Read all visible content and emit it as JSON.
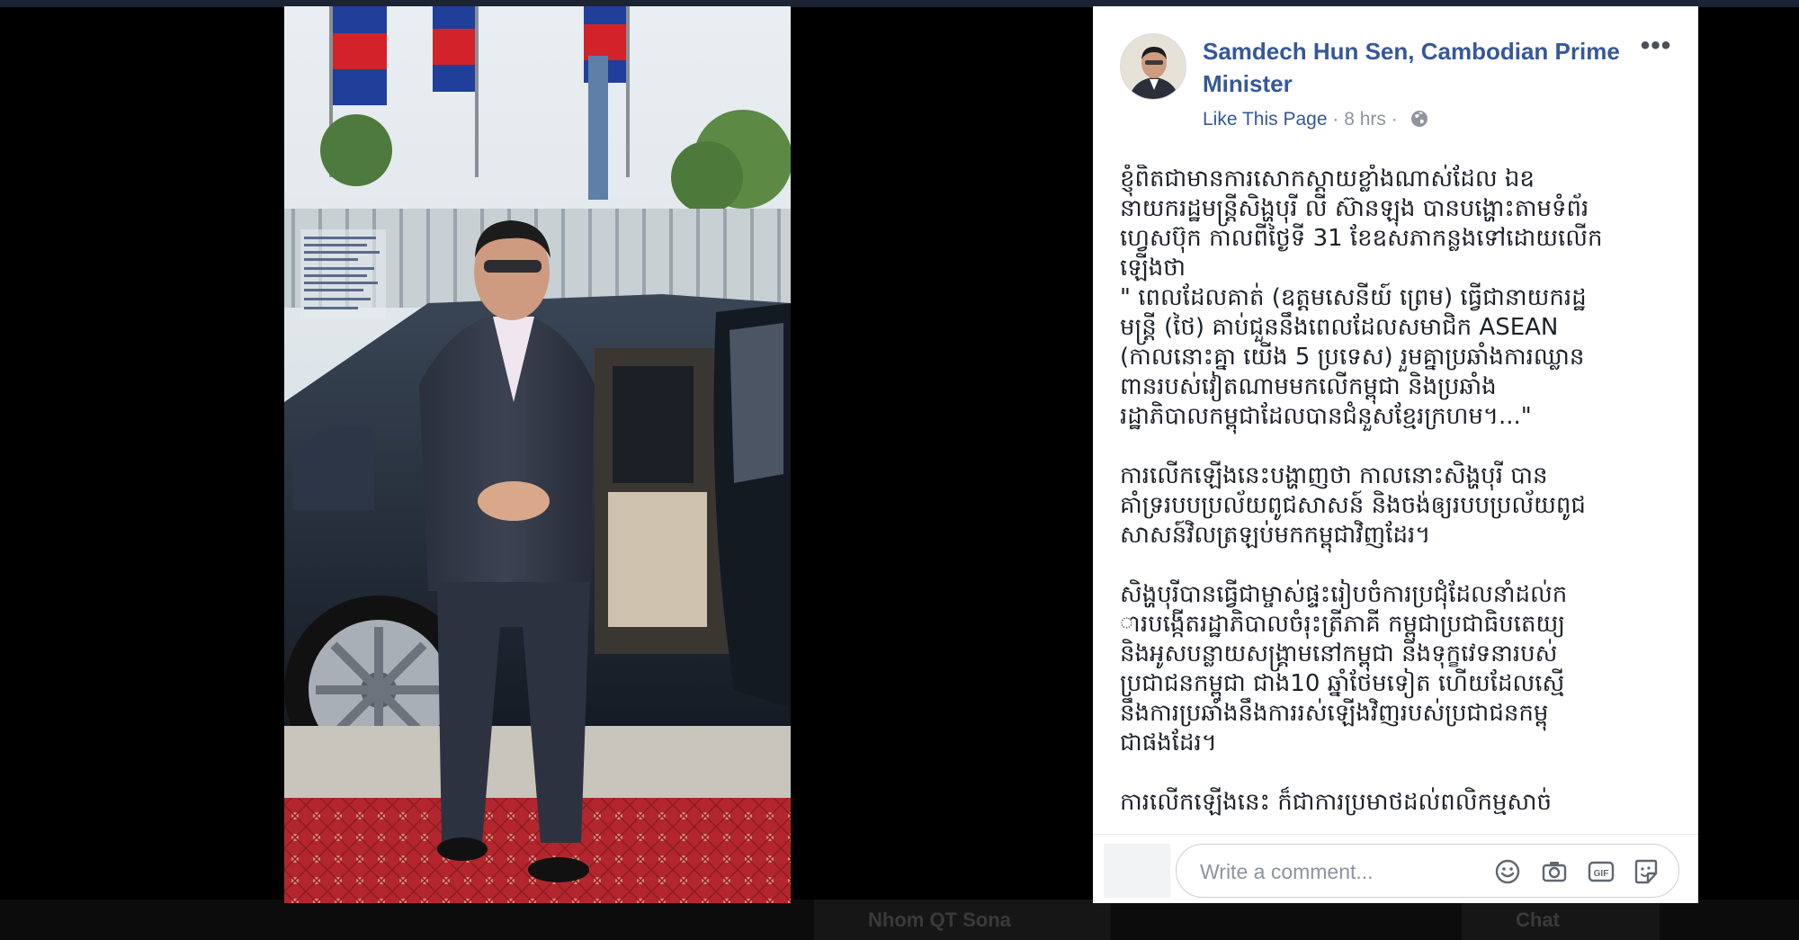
{
  "post": {
    "page_name": "Samdech Hun Sen, Cambodian Prime Minister",
    "like_link": "Like This Page",
    "separator": "·",
    "time": "8 hrs",
    "more_label": "•••",
    "paragraphs": [
      "ខ្ញុំពិតជាមានការសោកស្ដាយខ្លាំងណាស់ដែល ឯឧ\nនាយករដ្ឋមន្ត្រីសិង្ហបុរី លី ស៊ានឡុង បានបង្ហោះតាមទំព័រ\nហ្វេសប៊ុក កាលពីថ្ងៃទី 31 ខែឧសភាកន្លងទៅដោយលើក\nឡើងថា\n\" ពេលដែលគាត់ (ឧត្តមសេនីយ៍ ព្រេម) ធ្វើជានាយករដ្ឋ\nមន្ត្រី (ថៃ) គាប់ជួននឹងពេលដែលសមាជិក ASEAN\n(កាលនោះគ្នា យើង 5 ប្រទេស) រួមគ្នាប្រឆាំងការឈ្លាន\nពានរបស់វៀតណាមមកលើកម្ពុជា និងប្រឆាំង\nរដ្ឋាភិបាលកម្ពុជាដែលបានជំនួសខ្មែរក្រហម។...\"",
      "ការលើកឡើងនេះបង្ហាញថា កាលនោះសិង្ហបុរី បាន\nគាំទ្ររបបប្រល័យពូជសាសន៍ និងចង់ឲ្យរបបប្រល័យពូជ\nសាសន៍វិលត្រឡប់មកកម្ពុជាវិញដែរ។",
      "សិង្ហបុរីបានធ្វើជាម្ចាស់ផ្ទះរៀបចំការប្រជុំដែលនាំដល់ក\nារបង្កើតរដ្ឋាភិបាលចំរុះត្រីភាគី កម្ពុជាប្រជាធិបតេយ្យ\nនិងអូសបន្លាយសង្គ្រាមនៅកម្ពុជា និងទុក្ខវេទនារបស់\nប្រជាជនកម្ពុជា ជាង10 ឆ្នាំថែមទៀត ហើយដែលស្មើ\nនឹងការប្រឆាំងនឹងការរស់ឡើងវិញរបស់ប្រជាជនកម្ពុ\nជាផងដែរ។",
      "ការលើកឡើងនេះ ក៏ជាការប្រមាថដល់ពលិកម្មសាច់"
    ]
  },
  "comment": {
    "placeholder": "Write a comment..."
  },
  "icons": {
    "avatar": "profile-photo",
    "globe": "globe-icon",
    "emoji": "emoji-icon",
    "camera": "camera-icon",
    "gif": "gif-icon",
    "sticker": "sticker-icon"
  },
  "background": {
    "chat_chip": "Nhom QT Sona",
    "chat_label": "Chat"
  },
  "colors": {
    "link": "#365899",
    "meta": "#90949c",
    "text": "#1d2129"
  }
}
